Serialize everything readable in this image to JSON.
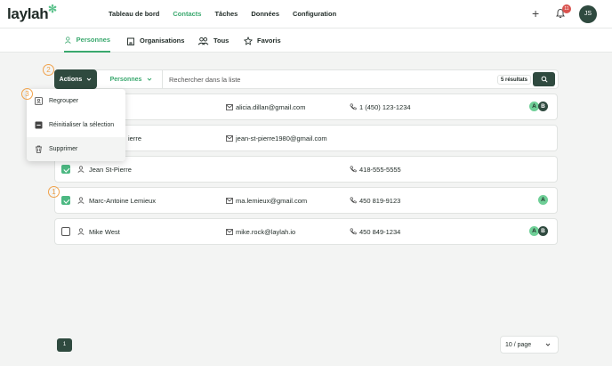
{
  "app": {
    "logo": "laylah",
    "logo_mark": "✻"
  },
  "nav": {
    "items": [
      "Tableau de bord",
      "Contacts",
      "Tâches",
      "Données",
      "Configuration"
    ],
    "active": "Contacts"
  },
  "header": {
    "add_icon": "plus-icon",
    "notification_icon": "bell-icon",
    "notification_count": "11",
    "user_initials": "JS"
  },
  "subnav": {
    "tabs": [
      {
        "label": "Personnes",
        "icon": "person-icon",
        "active": true
      },
      {
        "label": "Organisations",
        "icon": "building-icon",
        "active": false
      },
      {
        "label": "Tous",
        "icon": "people-icon",
        "active": false
      },
      {
        "label": "Favoris",
        "icon": "star-icon",
        "active": false
      }
    ]
  },
  "markers": [
    "1",
    "2",
    "3"
  ],
  "toolbar": {
    "actions_label": "Actions",
    "filter_value": "Personnes",
    "search_placeholder": "Rechercher dans la liste",
    "results_label": "5 résultats"
  },
  "dropdown": {
    "items": [
      {
        "label": "Regrouper",
        "icon": "group-icon"
      },
      {
        "label": "Réinitialiser la sélection",
        "icon": "minus-square-icon"
      },
      {
        "label": "Supprimer",
        "icon": "trash-icon"
      }
    ]
  },
  "rows": [
    {
      "name": "",
      "email": "alicia.dillan@gmail.com",
      "phone": "1 (450) 123-1234",
      "tags": [
        "A",
        "B"
      ],
      "checked": null
    },
    {
      "name": "ierre",
      "email": "jean-st-pierre1980@gmail.com",
      "phone": "",
      "tags": [],
      "checked": null
    },
    {
      "name": "Jean St-Pierre",
      "email": "",
      "phone": "418-555-5555",
      "tags": [],
      "checked": true
    },
    {
      "name": "Marc-Antoine Lemieux",
      "email": "ma.lemieux@gmail.com",
      "phone": "450 819-9123",
      "tags": [
        "A"
      ],
      "checked": true
    },
    {
      "name": "Mike West",
      "email": "mike.rock@laylah.io",
      "phone": "450 849-1234",
      "tags": [
        "A",
        "B"
      ],
      "checked": false
    }
  ],
  "pagination": {
    "current_page": "1",
    "per_page": "10 / page"
  },
  "colors": {
    "brand_dark": "#2f4a3f",
    "accent_green": "#3aa86e",
    "tag_a": "#6fcf97",
    "marker": "#f0a24b",
    "badge_red": "#d9534f"
  }
}
